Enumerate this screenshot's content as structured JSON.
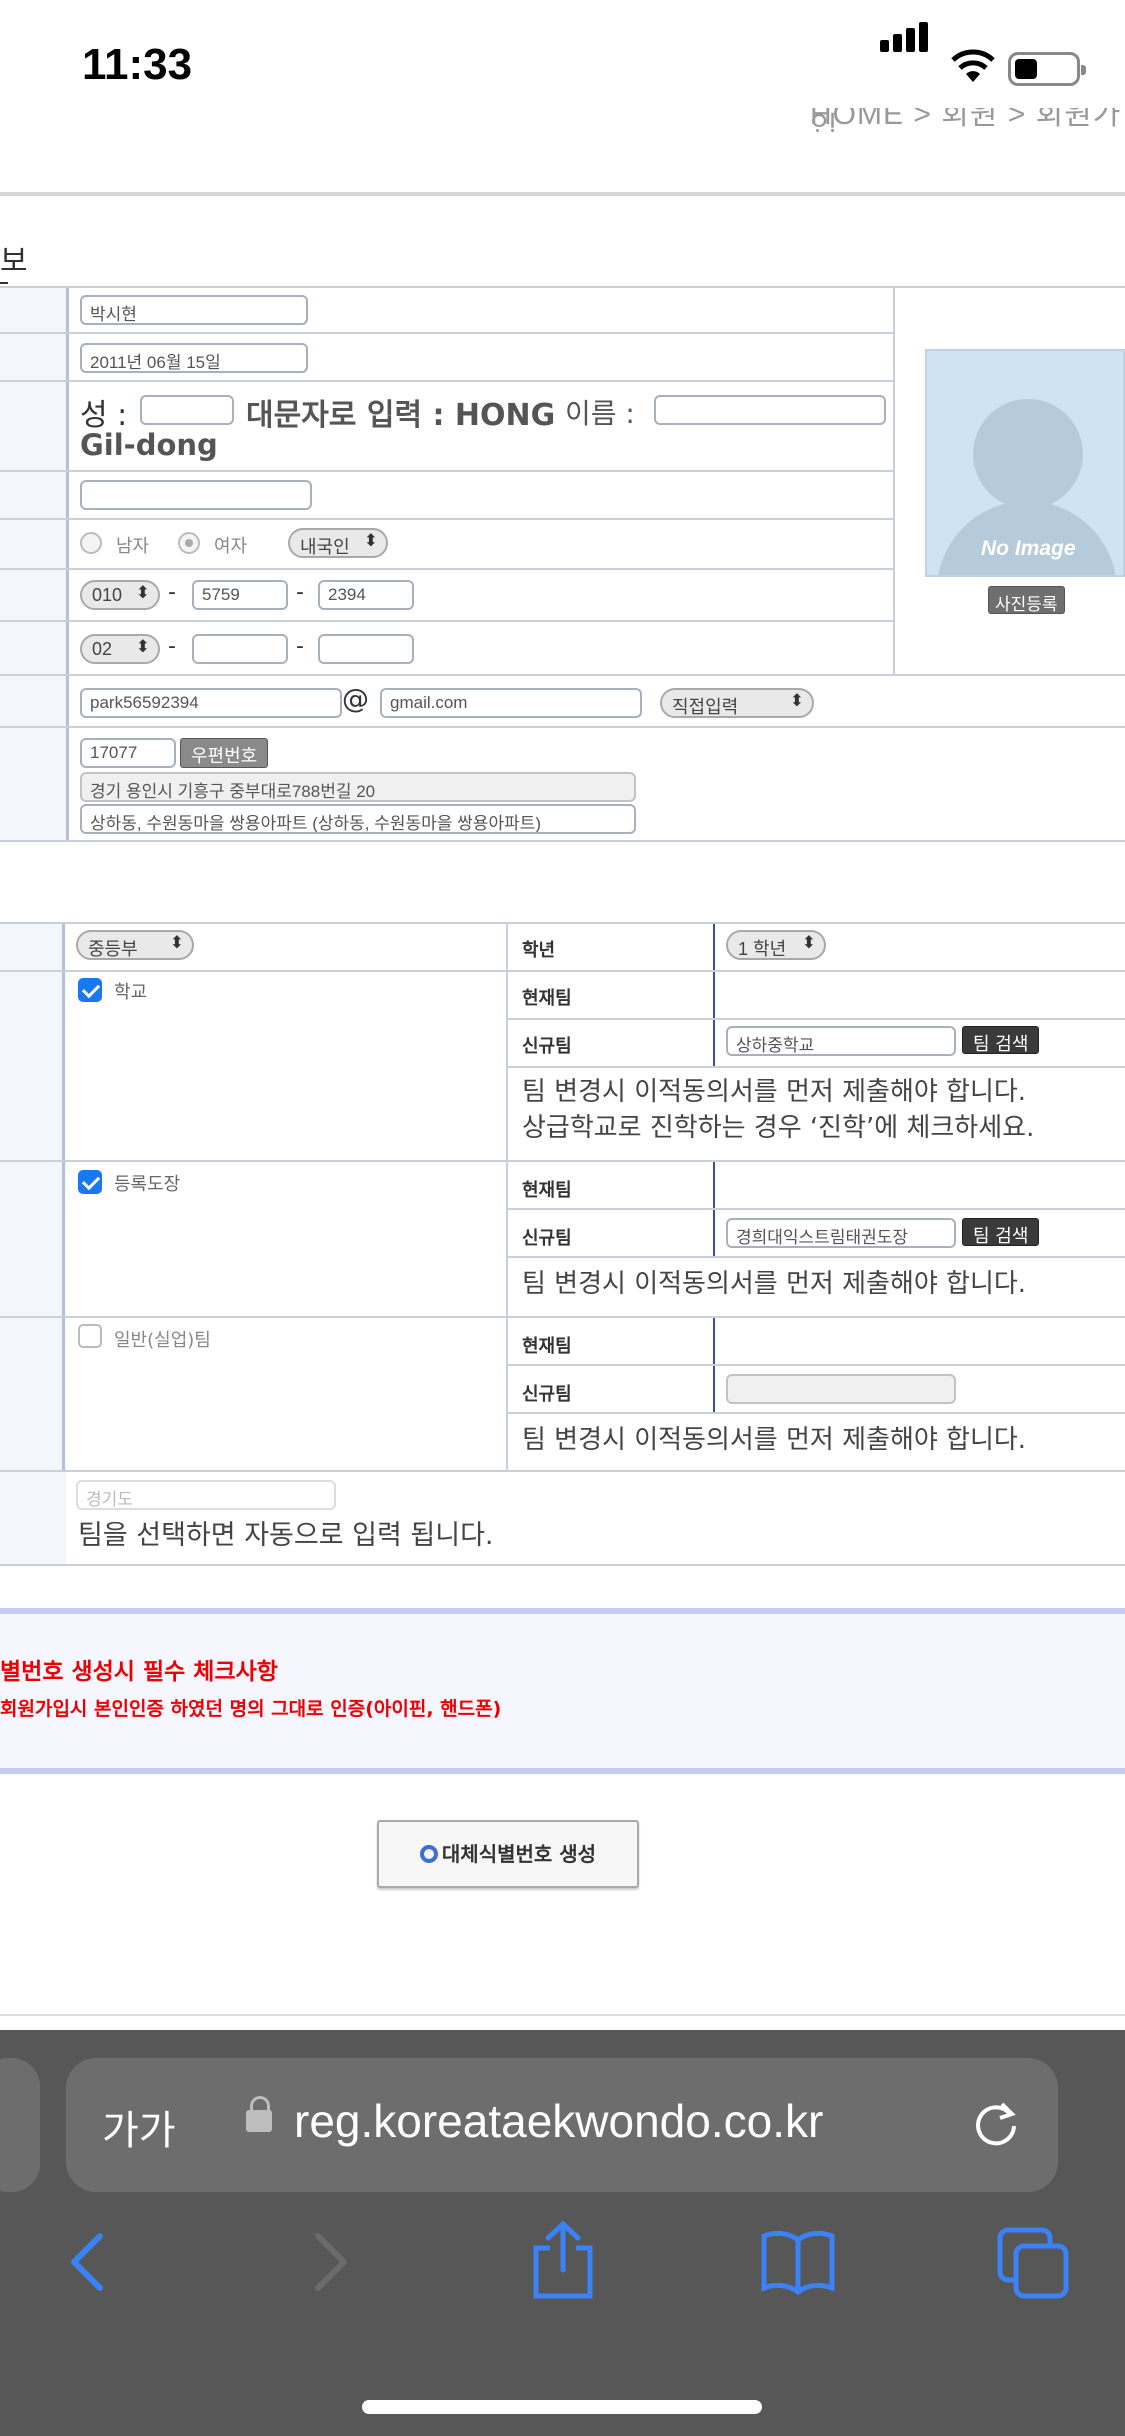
{
  "status_bar": {
    "time": "11:33"
  },
  "header": {
    "partial_text": "HOME > 회원 > 회원가입",
    "section_fragment": "보"
  },
  "member": {
    "name": "박시현",
    "birth": "2011년 06월 15일",
    "eng_last_label": "성 :",
    "eng_hint": "대문자로 입력 : HONG",
    "eng_first_label": "이름 :",
    "eng_example": "Gil-dong",
    "extra_field": "",
    "gender_male": "남자",
    "gender_female": "여자",
    "nationality": "내국인",
    "phone_prefix": "010",
    "phone_mid": "5759",
    "phone_last": "2394",
    "tel_prefix": "02",
    "tel_mid": "",
    "tel_last": "",
    "dash": "-",
    "email_id": "park56592394",
    "email_at": "@",
    "email_domain": "gmail.com",
    "email_select": "직접입력",
    "zip": "17077",
    "zip_button": "우편번호",
    "addr1": "경기 용인시 기흥구 중부대로788번길 20",
    "addr2": "상하동, 수원동마을 쌍용아파트 (상하동, 수원동마을 쌍용아파트)",
    "photo_no_image": "No Image",
    "photo_button": "사진등록"
  },
  "team": {
    "division": "중등부",
    "grade_label": "학년",
    "grade": "1 학년",
    "school_label": "학교",
    "dojang_label": "등록도장",
    "general_label": "일반(실업)팀",
    "current_team_label": "현재팀",
    "new_team_label": "신규팀",
    "school_new_team": "상하중학교",
    "dojang_new_team": "경희대익스트림태권도장",
    "general_new_team": "",
    "search_button": "팀 검색",
    "notice_change": "팀 변경시 이적동의서를 먼저 제출해야 합니다.",
    "notice_school_2": "상급학교로 진학하는 경우 ‘진학’에 체크하세요.",
    "region_placeholder": "경기도",
    "region_notice": "팀을 선택하면 자동으로 입력 됩니다."
  },
  "notice_band": {
    "heading": "별번호 생성시 필수 체크사항",
    "sub": "회원가입시 본인인증 하였던 명의 그대로 인증(아이핀, 핸드폰)"
  },
  "generate_button": "대체식별번호 생성",
  "browser": {
    "aa_label": "가가",
    "url": "reg.koreataekwondo.co.kr"
  }
}
